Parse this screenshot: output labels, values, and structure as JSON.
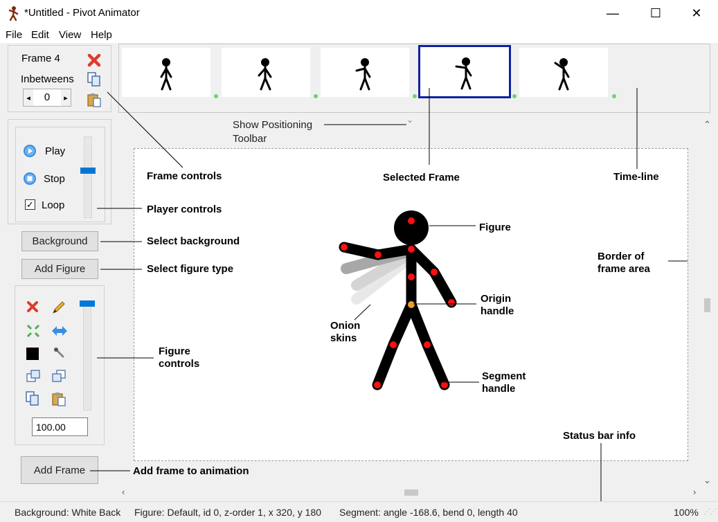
{
  "window": {
    "title": "*Untitled - Pivot Animator",
    "minimize": "—",
    "maximize": "☐",
    "close": "✕"
  },
  "menu": [
    "File",
    "Edit",
    "View",
    "Help"
  ],
  "frame_controls": {
    "frame_label": "Frame 4",
    "inbetweens_label": "Inbetweens",
    "inbetweens_value": "0",
    "spin_left": "◂",
    "spin_right": "▸"
  },
  "player": {
    "play_label": "Play",
    "stop_label": "Stop",
    "loop_label": "Loop",
    "loop_checked": true
  },
  "buttons": {
    "background": "Background",
    "add_figure": "Add Figure",
    "add_frame": "Add Frame"
  },
  "figure_controls": {
    "scale_value": "100.00"
  },
  "show_toolbar_label": "Show Positioning\nToolbar",
  "annotations": {
    "frame_controls": "Frame controls",
    "player_controls": "Player controls",
    "select_background": "Select background",
    "select_figure_type": "Select figure type",
    "figure_controls": "Figure\ncontrols",
    "add_frame": "Add frame to animation",
    "selected_frame": "Selected Frame",
    "timeline": "Time-line",
    "figure": "Figure",
    "border": "Border of\nframe area",
    "origin": "Origin\nhandle",
    "onion": "Onion\nskins",
    "segment": "Segment\nhandle",
    "status_info": "Status bar info"
  },
  "status": {
    "background": "Background: White Back",
    "figure": "Figure: Default,  id 0,  z-order 1,  x 320, y 180",
    "segment": "Segment: angle -168.6,  bend 0,  length 40",
    "zoom": "100%"
  },
  "colors": {
    "handle_red": "#ff1010",
    "origin_orange": "#f0a020",
    "selected_frame_border": "#1020a0",
    "slider_blue": "#0078d7"
  }
}
